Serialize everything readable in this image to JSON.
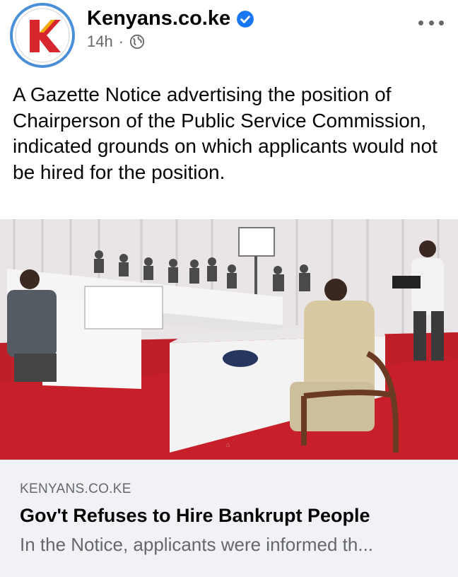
{
  "post": {
    "page_name": "Kenyans.co.ke",
    "verified_icon": "verified-badge-icon",
    "timestamp": "14h",
    "separator": "·",
    "audience_icon": "globe-icon",
    "caption": "A Gazette Notice advertising the position of Chairperson of the Public Service Commission, indicated grounds on which applicants would not be hired for the position."
  },
  "link": {
    "domain": "KENYANS.CO.KE",
    "title": "Gov't Refuses to Hire Bankrupt People",
    "description": "In the Notice, applicants were informed th..."
  },
  "colors": {
    "verified_blue": "#1877f2",
    "avatar_ring": "#4a90d9",
    "logo_red": "#d7262e",
    "carpet_red": "#c8202a"
  }
}
